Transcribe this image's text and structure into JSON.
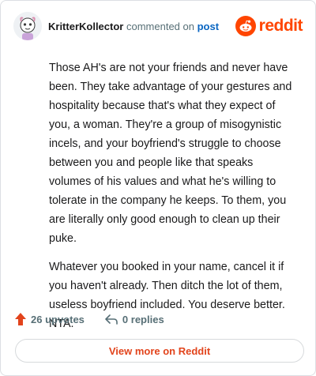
{
  "header": {
    "username": "KritterKollector",
    "action_text": "commented on",
    "target_link": "post",
    "brand_name": "reddit",
    "brand_color": "#ff4500"
  },
  "comment": {
    "paragraphs": [
      "Those AH's are not your friends and never have been. They take advantage of your gestures and hospitality because that's what they expect of you, a woman. They're a group of misogynistic incels, and your boyfriend's struggle to choose between you and people like that speaks volumes of his values and what he's willing to tolerate in the company he keeps. To them, you are literally only good enough to clean up their puke.",
      "Whatever you booked in your name, cancel it if you haven't already. Then ditch the lot of them, useless boyfriend included. You deserve better. NTA."
    ]
  },
  "footer": {
    "upvotes": "26 upvotes",
    "replies": "0 replies",
    "upvote_icon": "upvote-arrow-icon",
    "reply_icon": "reply-arrow-icon",
    "view_more_label": "View more on Reddit",
    "accent": "#e2441c"
  }
}
